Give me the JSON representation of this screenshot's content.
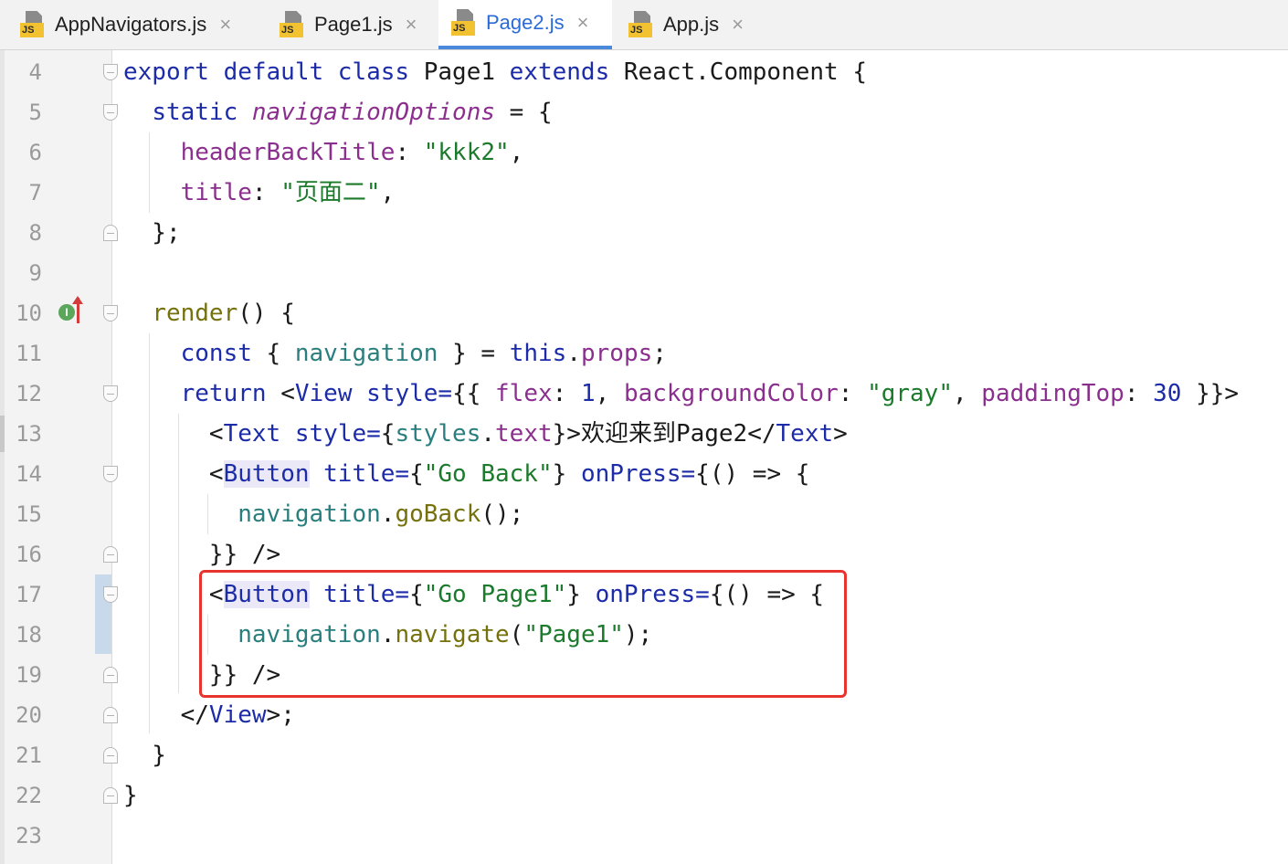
{
  "tabs": [
    {
      "label": "AppNavigators.js",
      "icon": "js-file-icon",
      "active": false
    },
    {
      "label": "Page1.js",
      "icon": "js-file-icon",
      "active": false
    },
    {
      "label": "Page2.js",
      "icon": "js-file-icon",
      "active": true
    },
    {
      "label": "App.js",
      "icon": "js-file-icon",
      "active": false
    }
  ],
  "js_badge": "JS",
  "close_glyph": "×",
  "gutter": {
    "line_numbers": [
      "4",
      "5",
      "6",
      "7",
      "8",
      "9",
      "10",
      "11",
      "12",
      "13",
      "14",
      "15",
      "16",
      "17",
      "18",
      "19",
      "20",
      "21",
      "22",
      "23"
    ],
    "implement_marker": "I"
  },
  "code_lines": [
    "export default class Page1 extends React.Component {",
    "  static navigationOptions = {",
    "    headerBackTitle: \"kkk2\",",
    "    title: \"页面二\",",
    "  };",
    "",
    "  render() {",
    "    const { navigation } = this.props;",
    "    return <View style={{ flex: 1, backgroundColor: \"gray\", paddingTop: 30 }}>",
    "      <Text style={styles.text}>欢迎来到Page2</Text>",
    "      <Button title={\"Go Back\"} onPress={() => {",
    "        navigation.goBack();",
    "      }} />",
    "      <Button title={\"Go Page1\"} onPress={() => {",
    "        navigation.navigate(\"Page1\");",
    "      }} />",
    "    </View>;",
    "  }",
    "}",
    ""
  ],
  "colors": {
    "keyword": "#1c2ca8",
    "field": "#8b2f8e",
    "string": "#1b7a2b",
    "function": "#75710e",
    "variable": "#2a7f7e",
    "active_tab": "#2b6bd6",
    "highlight_box": "#e8342e"
  }
}
